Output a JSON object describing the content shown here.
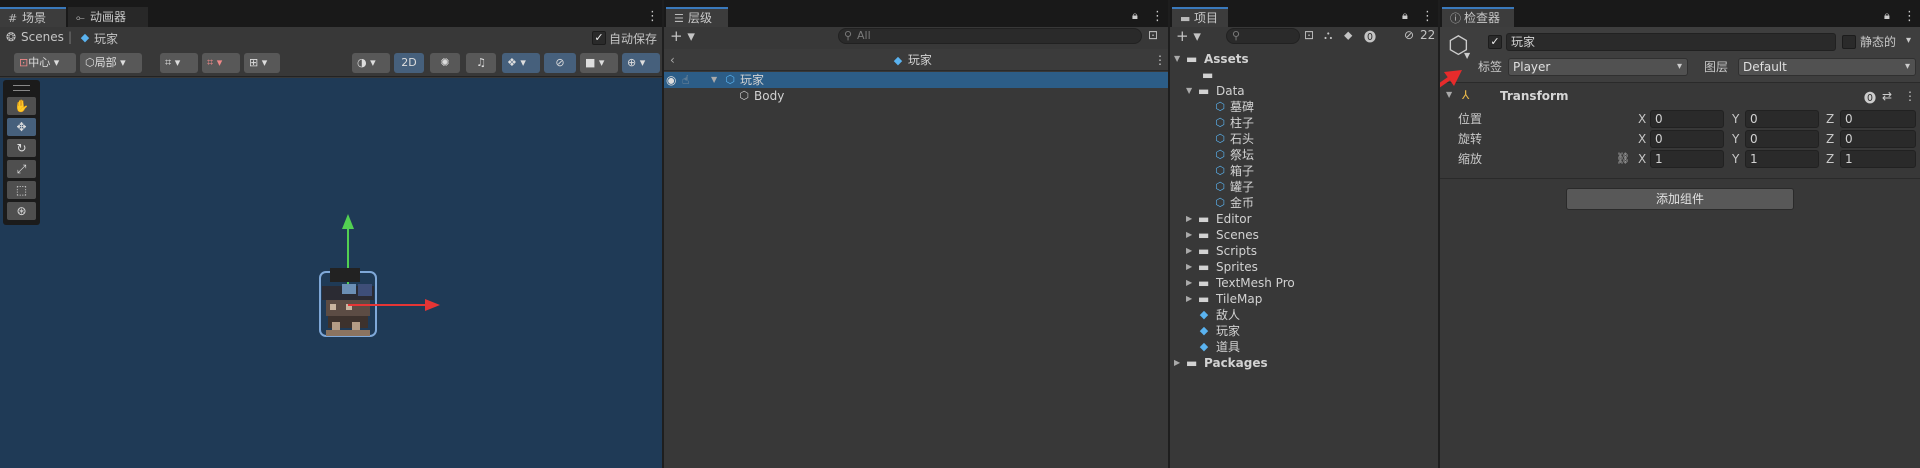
{
  "scene": {
    "tabs": [
      "场景",
      "动画器"
    ],
    "breadcrumb": {
      "root": "Scenes",
      "separator": "|",
      "object": "玩家"
    },
    "autosave_label": "自动保存",
    "pivot_label": "中心",
    "space_label": "局部",
    "mode_2d": "2D"
  },
  "hierarchy": {
    "tab": "层级",
    "search_placeholder": "All",
    "prefab_title": "玩家",
    "items": [
      {
        "label": "玩家",
        "selected": true
      },
      {
        "label": "Body",
        "selected": false
      }
    ]
  },
  "project": {
    "tab": "项目",
    "hidden_count": "22",
    "tree": {
      "assets": "Assets",
      "data": "Data",
      "data_items": [
        "墓碑",
        "柱子",
        "石头",
        "祭坛",
        "箱子",
        "罐子",
        "金币"
      ],
      "folders": [
        "Editor",
        "Scenes",
        "Scripts",
        "Sprites",
        "TextMesh Pro",
        "TileMap"
      ],
      "prefabs": [
        "敌人",
        "玩家",
        "道具"
      ],
      "packages": "Packages"
    }
  },
  "inspector": {
    "tab": "检查器",
    "object_name": "玩家",
    "static_label": "静态的",
    "tag_label": "标签",
    "tag_value": "Player",
    "layer_label": "图层",
    "layer_value": "Default",
    "component": "Transform",
    "rows": [
      {
        "label": "位置",
        "x": "0",
        "y": "0",
        "z": "0"
      },
      {
        "label": "旋转",
        "x": "0",
        "y": "0",
        "z": "0"
      },
      {
        "label": "缩放",
        "x": "1",
        "y": "1",
        "z": "1"
      }
    ],
    "axis": {
      "x": "X",
      "y": "Y",
      "z": "Z"
    },
    "add_component": "添加组件"
  },
  "colors": {
    "viewport": "#1f3a56",
    "selection": "#2c5d87",
    "accent": "#3a79bb",
    "gizmo_x": "#e53535",
    "gizmo_y": "#52d052",
    "annotation_arrow": "#e62b2b"
  }
}
